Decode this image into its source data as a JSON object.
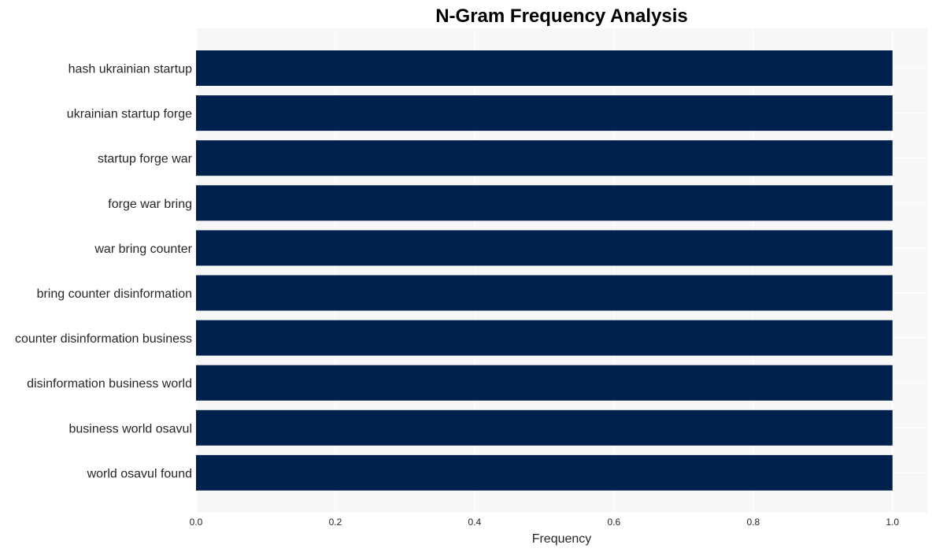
{
  "chart_data": {
    "type": "bar",
    "orientation": "horizontal",
    "title": "N-Gram Frequency Analysis",
    "xlabel": "Frequency",
    "ylabel": "",
    "categories": [
      "hash ukrainian startup",
      "ukrainian startup forge",
      "startup forge war",
      "forge war bring",
      "war bring counter",
      "bring counter disinformation",
      "counter disinformation business",
      "disinformation business world",
      "business world osavul",
      "world osavul found"
    ],
    "values": [
      1,
      1,
      1,
      1,
      1,
      1,
      1,
      1,
      1,
      1
    ],
    "xlim": [
      0,
      1.05
    ],
    "xticks": [
      0.0,
      0.2,
      0.4,
      0.6,
      0.8,
      1.0
    ],
    "xtick_labels": [
      "0.0",
      "0.2",
      "0.4",
      "0.6",
      "0.8",
      "1.0"
    ],
    "grid": true,
    "legend": "none",
    "colors": {
      "bar": "#00204e",
      "plot_background": "#f7f7f7",
      "grid": "#ffffff",
      "text": "#262626"
    }
  }
}
